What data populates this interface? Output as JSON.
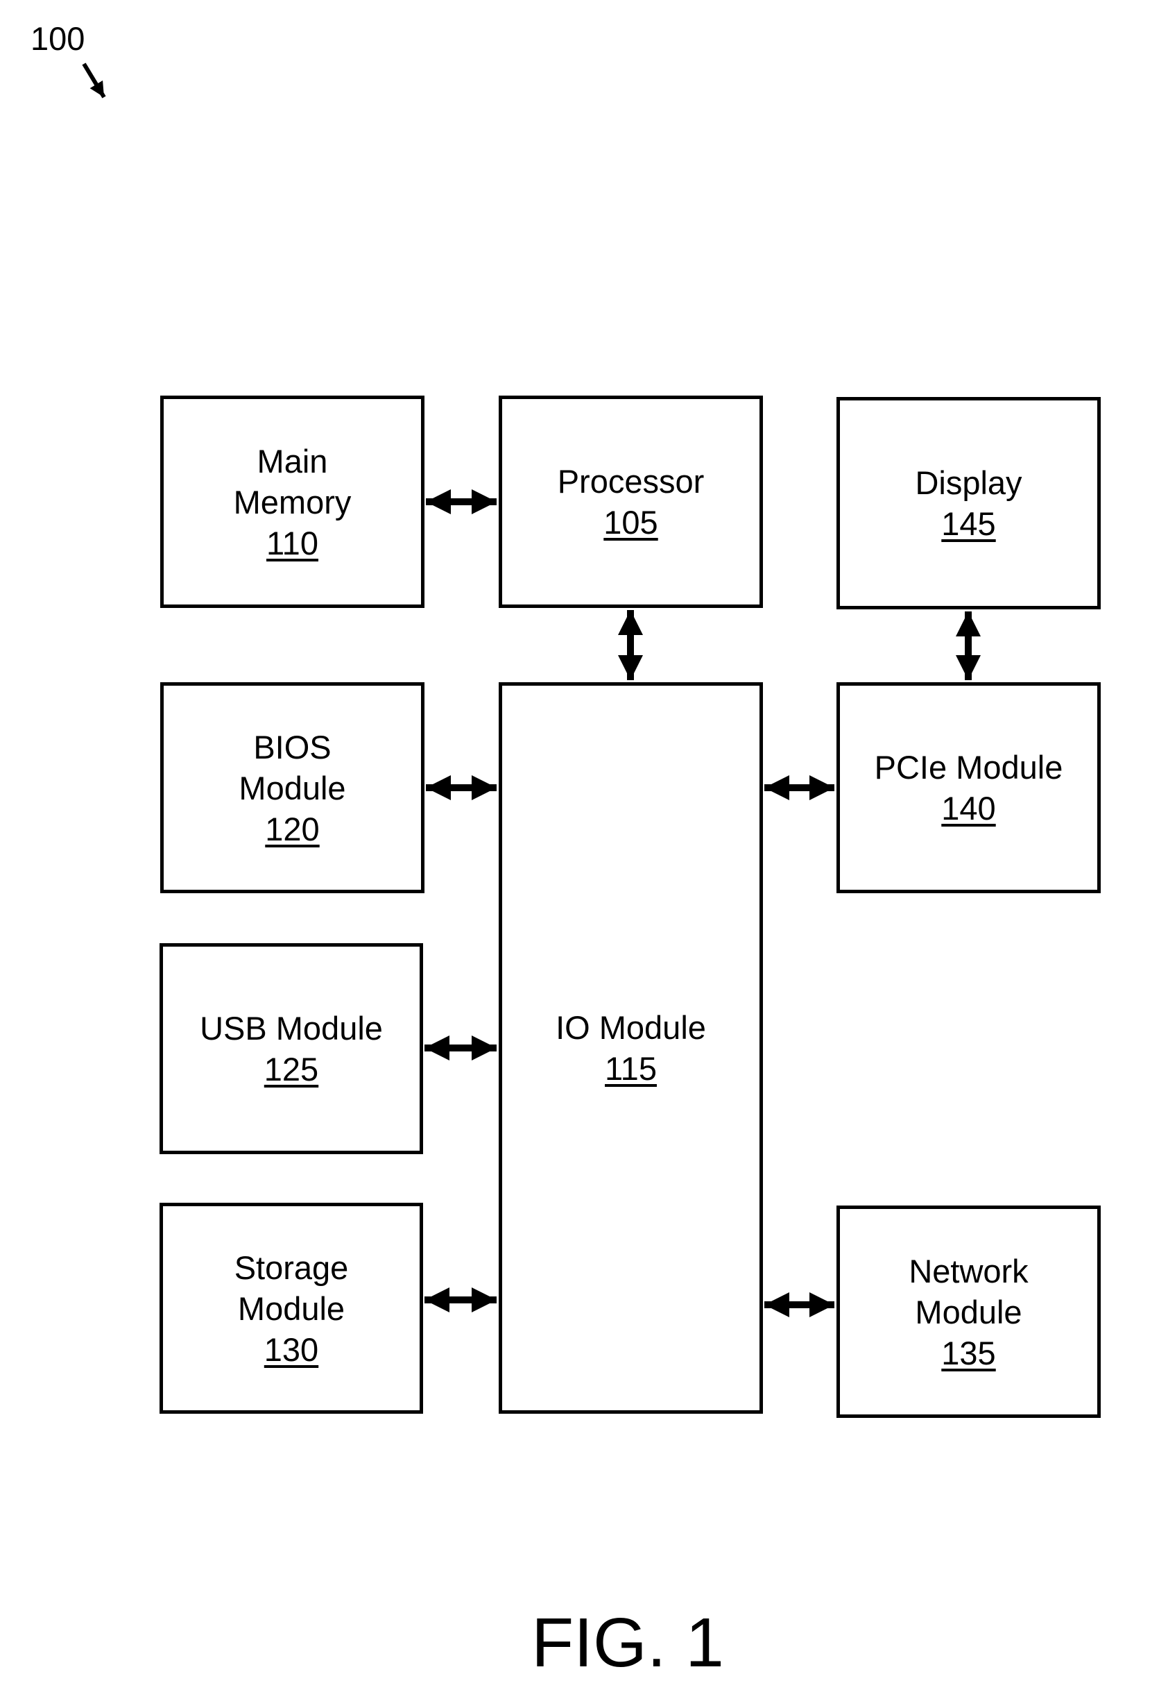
{
  "figure": {
    "reference_number": "100",
    "caption": "FIG. 1"
  },
  "blocks": {
    "main_memory": {
      "name": "Main\nMemory",
      "ref": "110"
    },
    "processor": {
      "name": "Processor",
      "ref": "105"
    },
    "display": {
      "name": "Display",
      "ref": "145"
    },
    "bios": {
      "name": "BIOS\nModule",
      "ref": "120"
    },
    "io": {
      "name": "IO Module",
      "ref": "115"
    },
    "pcie": {
      "name": "PCIe Module",
      "ref": "140"
    },
    "usb": {
      "name": "USB Module",
      "ref": "125"
    },
    "storage": {
      "name": "Storage\nModule",
      "ref": "130"
    },
    "network": {
      "name": "Network\nModule",
      "ref": "135"
    }
  },
  "connections": [
    {
      "from": "main_memory",
      "to": "processor",
      "type": "bidirectional"
    },
    {
      "from": "processor",
      "to": "io",
      "type": "bidirectional"
    },
    {
      "from": "display",
      "to": "pcie",
      "type": "bidirectional"
    },
    {
      "from": "bios",
      "to": "io",
      "type": "bidirectional"
    },
    {
      "from": "io",
      "to": "pcie",
      "type": "bidirectional"
    },
    {
      "from": "usb",
      "to": "io",
      "type": "bidirectional"
    },
    {
      "from": "storage",
      "to": "io",
      "type": "bidirectional"
    },
    {
      "from": "io",
      "to": "network",
      "type": "bidirectional"
    }
  ]
}
